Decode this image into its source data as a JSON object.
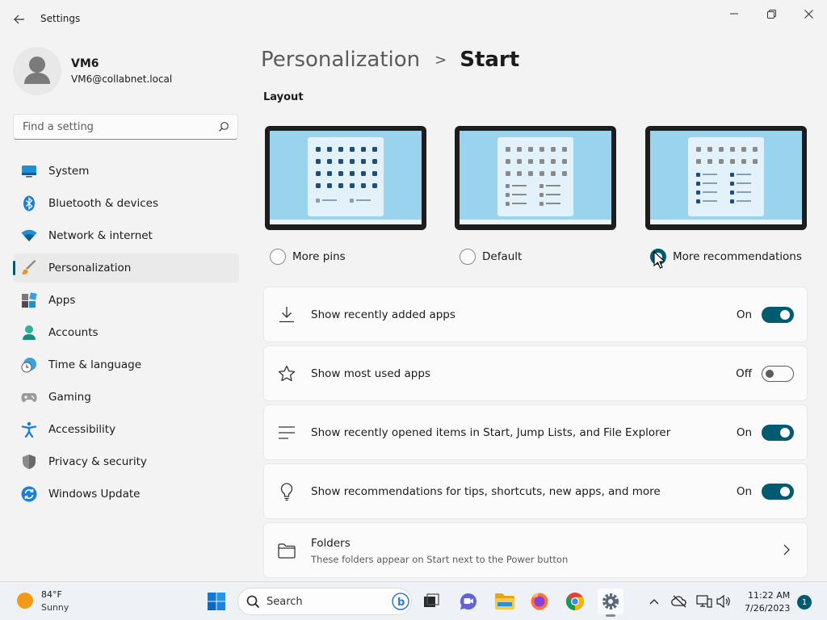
{
  "window": {
    "title": "Settings"
  },
  "profile": {
    "name": "VM6",
    "email": "VM6@collabnet.local"
  },
  "search": {
    "placeholder": "Find a setting"
  },
  "sidebar": {
    "items": [
      {
        "label": "System",
        "icon": "system-icon"
      },
      {
        "label": "Bluetooth & devices",
        "icon": "bluetooth-icon"
      },
      {
        "label": "Network & internet",
        "icon": "wifi-icon"
      },
      {
        "label": "Personalization",
        "icon": "brush-icon",
        "active": true
      },
      {
        "label": "Apps",
        "icon": "apps-icon"
      },
      {
        "label": "Accounts",
        "icon": "accounts-icon"
      },
      {
        "label": "Time & language",
        "icon": "time-language-icon"
      },
      {
        "label": "Gaming",
        "icon": "gamepad-icon"
      },
      {
        "label": "Accessibility",
        "icon": "accessibility-icon"
      },
      {
        "label": "Privacy & security",
        "icon": "shield-icon"
      },
      {
        "label": "Windows Update",
        "icon": "update-icon"
      }
    ]
  },
  "breadcrumb": {
    "parent": "Personalization",
    "separator": ">",
    "current": "Start"
  },
  "layout": {
    "section_label": "Layout",
    "options": [
      {
        "label": "More pins",
        "selected": false
      },
      {
        "label": "Default",
        "selected": false
      },
      {
        "label": "More recommendations",
        "selected": true
      }
    ]
  },
  "settings": [
    {
      "label": "Show recently added apps",
      "state": "On",
      "icon": "download-icon"
    },
    {
      "label": "Show most used apps",
      "state": "Off",
      "icon": "star-icon"
    },
    {
      "label": "Show recently opened items in Start, Jump Lists, and File Explorer",
      "state": "On",
      "icon": "list-icon"
    },
    {
      "label": "Show recommendations for tips, shortcuts, new apps, and more",
      "state": "On",
      "icon": "lightbulb-icon"
    }
  ],
  "folders": {
    "title": "Folders",
    "description": "These folders appear on Start next to the Power button"
  },
  "taskbar": {
    "weather_temp": "84°F",
    "weather_condition": "Sunny",
    "search_label": "Search",
    "time": "11:22 AM",
    "date": "7/26/2023",
    "notification_count": "1"
  },
  "colors": {
    "accent": "#005a70",
    "preview_wallpaper": "#99d3ee"
  }
}
